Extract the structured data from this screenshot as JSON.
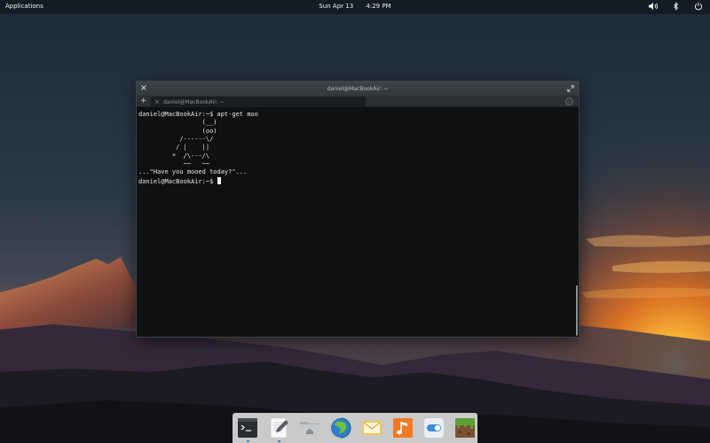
{
  "panel": {
    "applications_label": "Applications",
    "date": "Sun Apr 13",
    "time": "4:29 PM",
    "indicators": [
      "volume-icon",
      "bluetooth-icon",
      "power-icon"
    ]
  },
  "terminal": {
    "window_title": "daniel@MacBookAir: ~",
    "new_tab_label": "+",
    "tab": {
      "close_label": "×",
      "label": "daniel@MacBookAir: ~"
    },
    "lines": [
      "daniel@MacBookAir:~$ apt-get moo",
      "                 (__)",
      "                 (oo)",
      "           /------\\/",
      "          / |    ||",
      "         *  /\\---/\\",
      "            ~~   ~~",
      "...\"Have you mooed today?\"..."
    ],
    "prompt": "daniel@MacBookAir:~$ "
  },
  "dock": {
    "items": [
      {
        "name": "terminal",
        "icon": "terminal-icon",
        "running": true
      },
      {
        "name": "scratch",
        "icon": "text-editor-icon",
        "running": true
      },
      {
        "name": "files",
        "icon": "folder-home-icon",
        "running": false
      },
      {
        "name": "browser",
        "icon": "web-browser-icon",
        "running": false
      },
      {
        "name": "mail",
        "icon": "mail-icon",
        "running": false
      },
      {
        "name": "music",
        "icon": "music-icon",
        "running": false
      },
      {
        "name": "settings",
        "icon": "switchboard-icon",
        "running": false
      },
      {
        "name": "minecraft",
        "icon": "minecraft-icon",
        "running": false
      }
    ]
  },
  "colors": {
    "terminal_bg": "#0f1011",
    "titlebar": "#3a4145",
    "dock_bg": "#e4e4e4",
    "sunset": "#ffb033",
    "running_indicator": "#3b7fd1"
  }
}
